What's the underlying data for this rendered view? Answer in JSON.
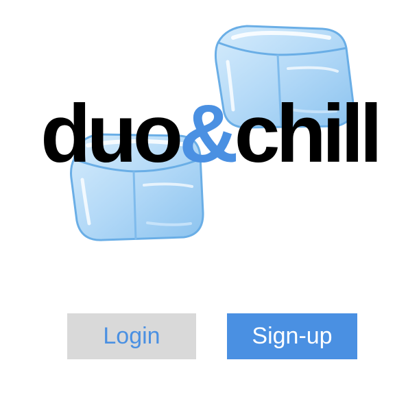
{
  "logo": {
    "part1": "duo",
    "amp": "&",
    "part2": "chill",
    "accent_color": "#4a90e2",
    "icon": "ice-cubes-icon"
  },
  "auth": {
    "login_label": "Login",
    "signup_label": "Sign-up"
  },
  "colors": {
    "primary": "#4a90e2",
    "secondary_bg": "#d9d9d9",
    "ice_light": "#cde6fa",
    "ice_mid": "#a9d3f5",
    "ice_dark": "#7ab8ea"
  }
}
